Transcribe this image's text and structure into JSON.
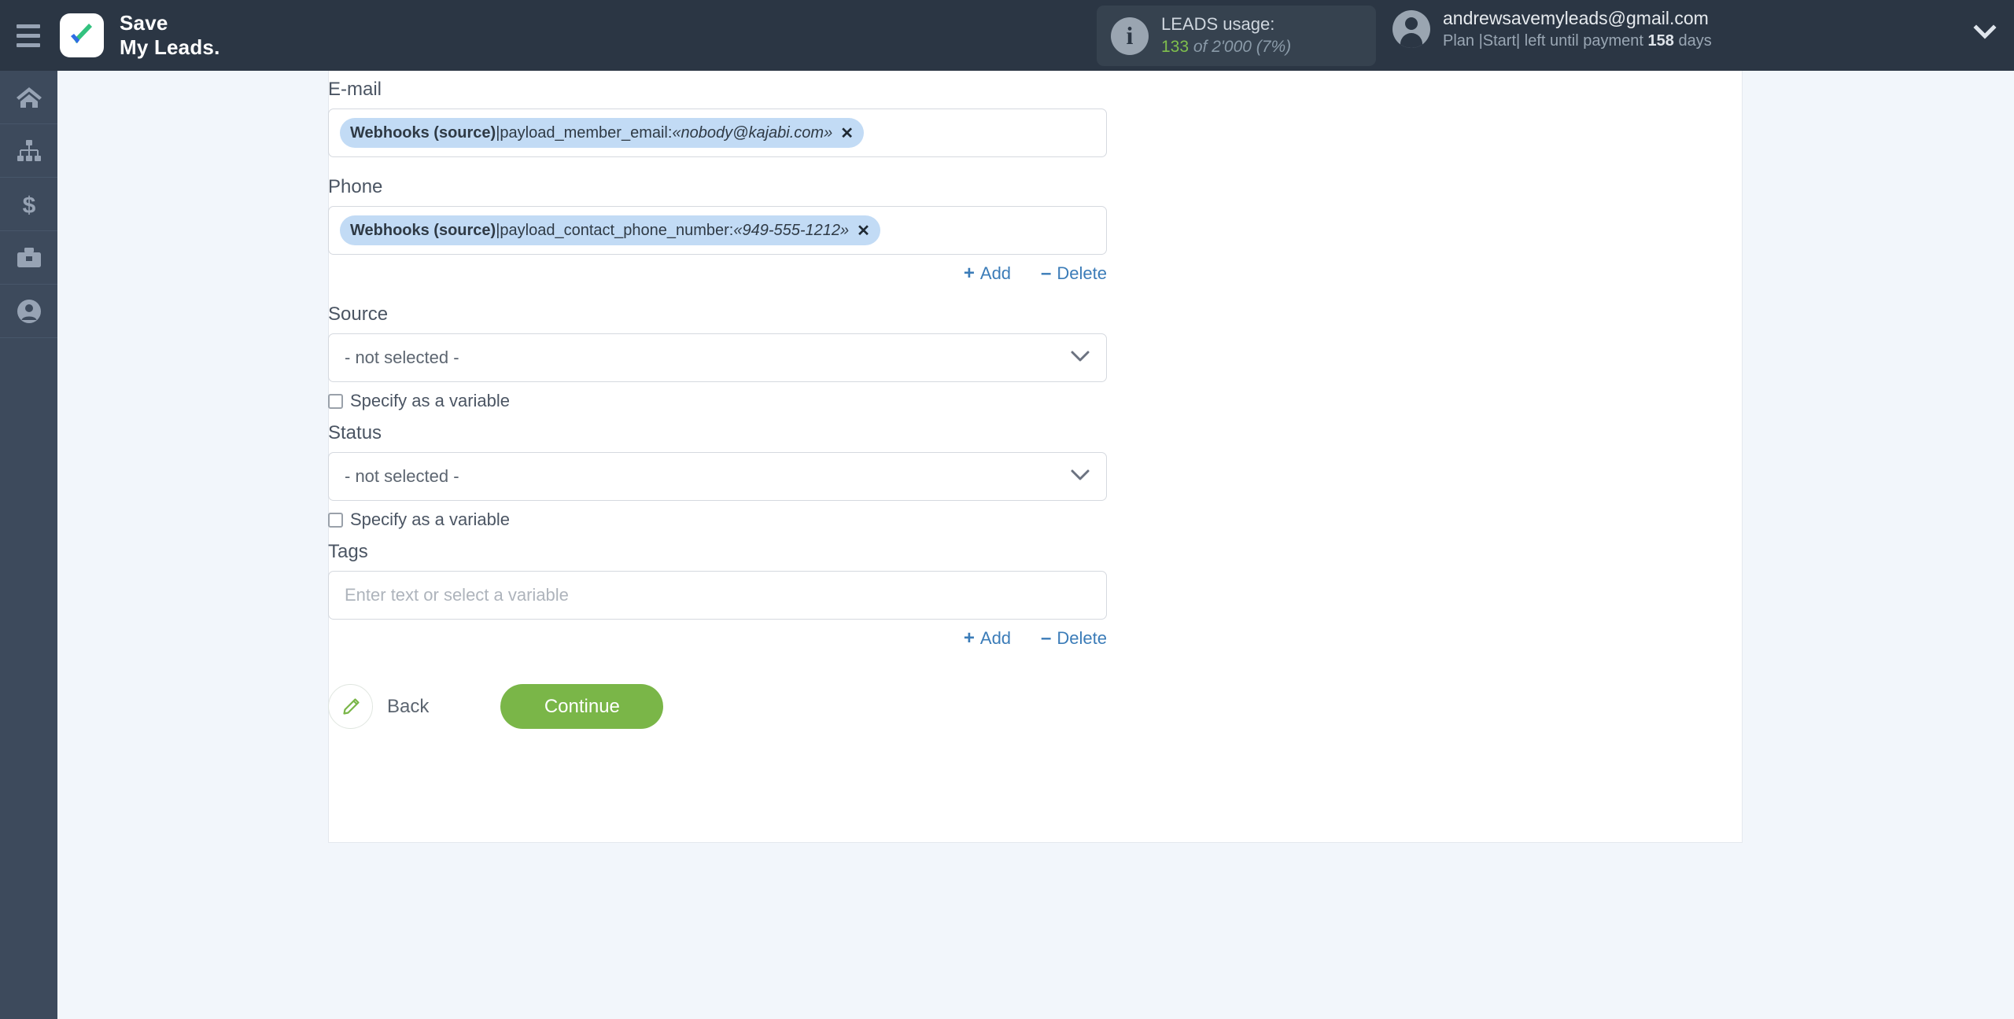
{
  "header": {
    "menu_icon": "hamburger-icon",
    "brand_line1": "Save",
    "brand_line2": "My Leads.",
    "usage": {
      "icon": "info-icon",
      "title": "LEADS usage:",
      "used": "133",
      "of": " of ",
      "total": "2'000",
      "percent": " (7%)"
    },
    "account": {
      "avatar": "avatar-icon",
      "email": "andrewsavemyleads@gmail.com",
      "plan_prefix": "Plan |Start| left until payment ",
      "plan_days": "158",
      "plan_suffix": " days",
      "caret": "chevron-down-icon"
    }
  },
  "sidebar": {
    "items": [
      {
        "name": "home",
        "icon": "home-icon"
      },
      {
        "name": "connections",
        "icon": "sitemap-icon"
      },
      {
        "name": "billing",
        "icon": "dollar-icon"
      },
      {
        "name": "services",
        "icon": "briefcase-icon"
      },
      {
        "name": "account",
        "icon": "user-circle-icon"
      }
    ]
  },
  "form": {
    "email": {
      "label": "E-mail",
      "chip_source": "Webhooks (source)",
      "chip_separator": " | ",
      "chip_key": "payload_member_email: ",
      "chip_value": "«nobody@kajabi.com»",
      "chip_remove": "✕"
    },
    "phone": {
      "label": "Phone",
      "chip_source": "Webhooks (source)",
      "chip_separator": " | ",
      "chip_key": "payload_contact_phone_number: ",
      "chip_value": "«949-555-1212»",
      "chip_remove": "✕"
    },
    "phone_links": {
      "add": "Add",
      "delete": "Delete",
      "add_sym": "+",
      "delete_sym": "–"
    },
    "source": {
      "label": "Source",
      "selected": "- not selected -",
      "checkbox_label": "Specify as a variable",
      "checked": false
    },
    "status": {
      "label": "Status",
      "selected": "- not selected -",
      "checkbox_label": "Specify as a variable",
      "checked": false
    },
    "tags": {
      "label": "Tags",
      "value": "",
      "placeholder": "Enter text or select a variable"
    },
    "tags_links": {
      "add": "Add",
      "delete": "Delete",
      "add_sym": "+",
      "delete_sym": "–"
    },
    "back_label": "Back",
    "continue_label": "Continue"
  },
  "colors": {
    "header_bg": "#2b3644",
    "sidebar_bg": "#3d4a5c",
    "page_bg": "#f2f6fb",
    "chip_bg": "#c2dbf5",
    "link_blue": "#3b7cb8",
    "continue_green": "#7ab648",
    "usage_green": "#7fbf4d"
  }
}
